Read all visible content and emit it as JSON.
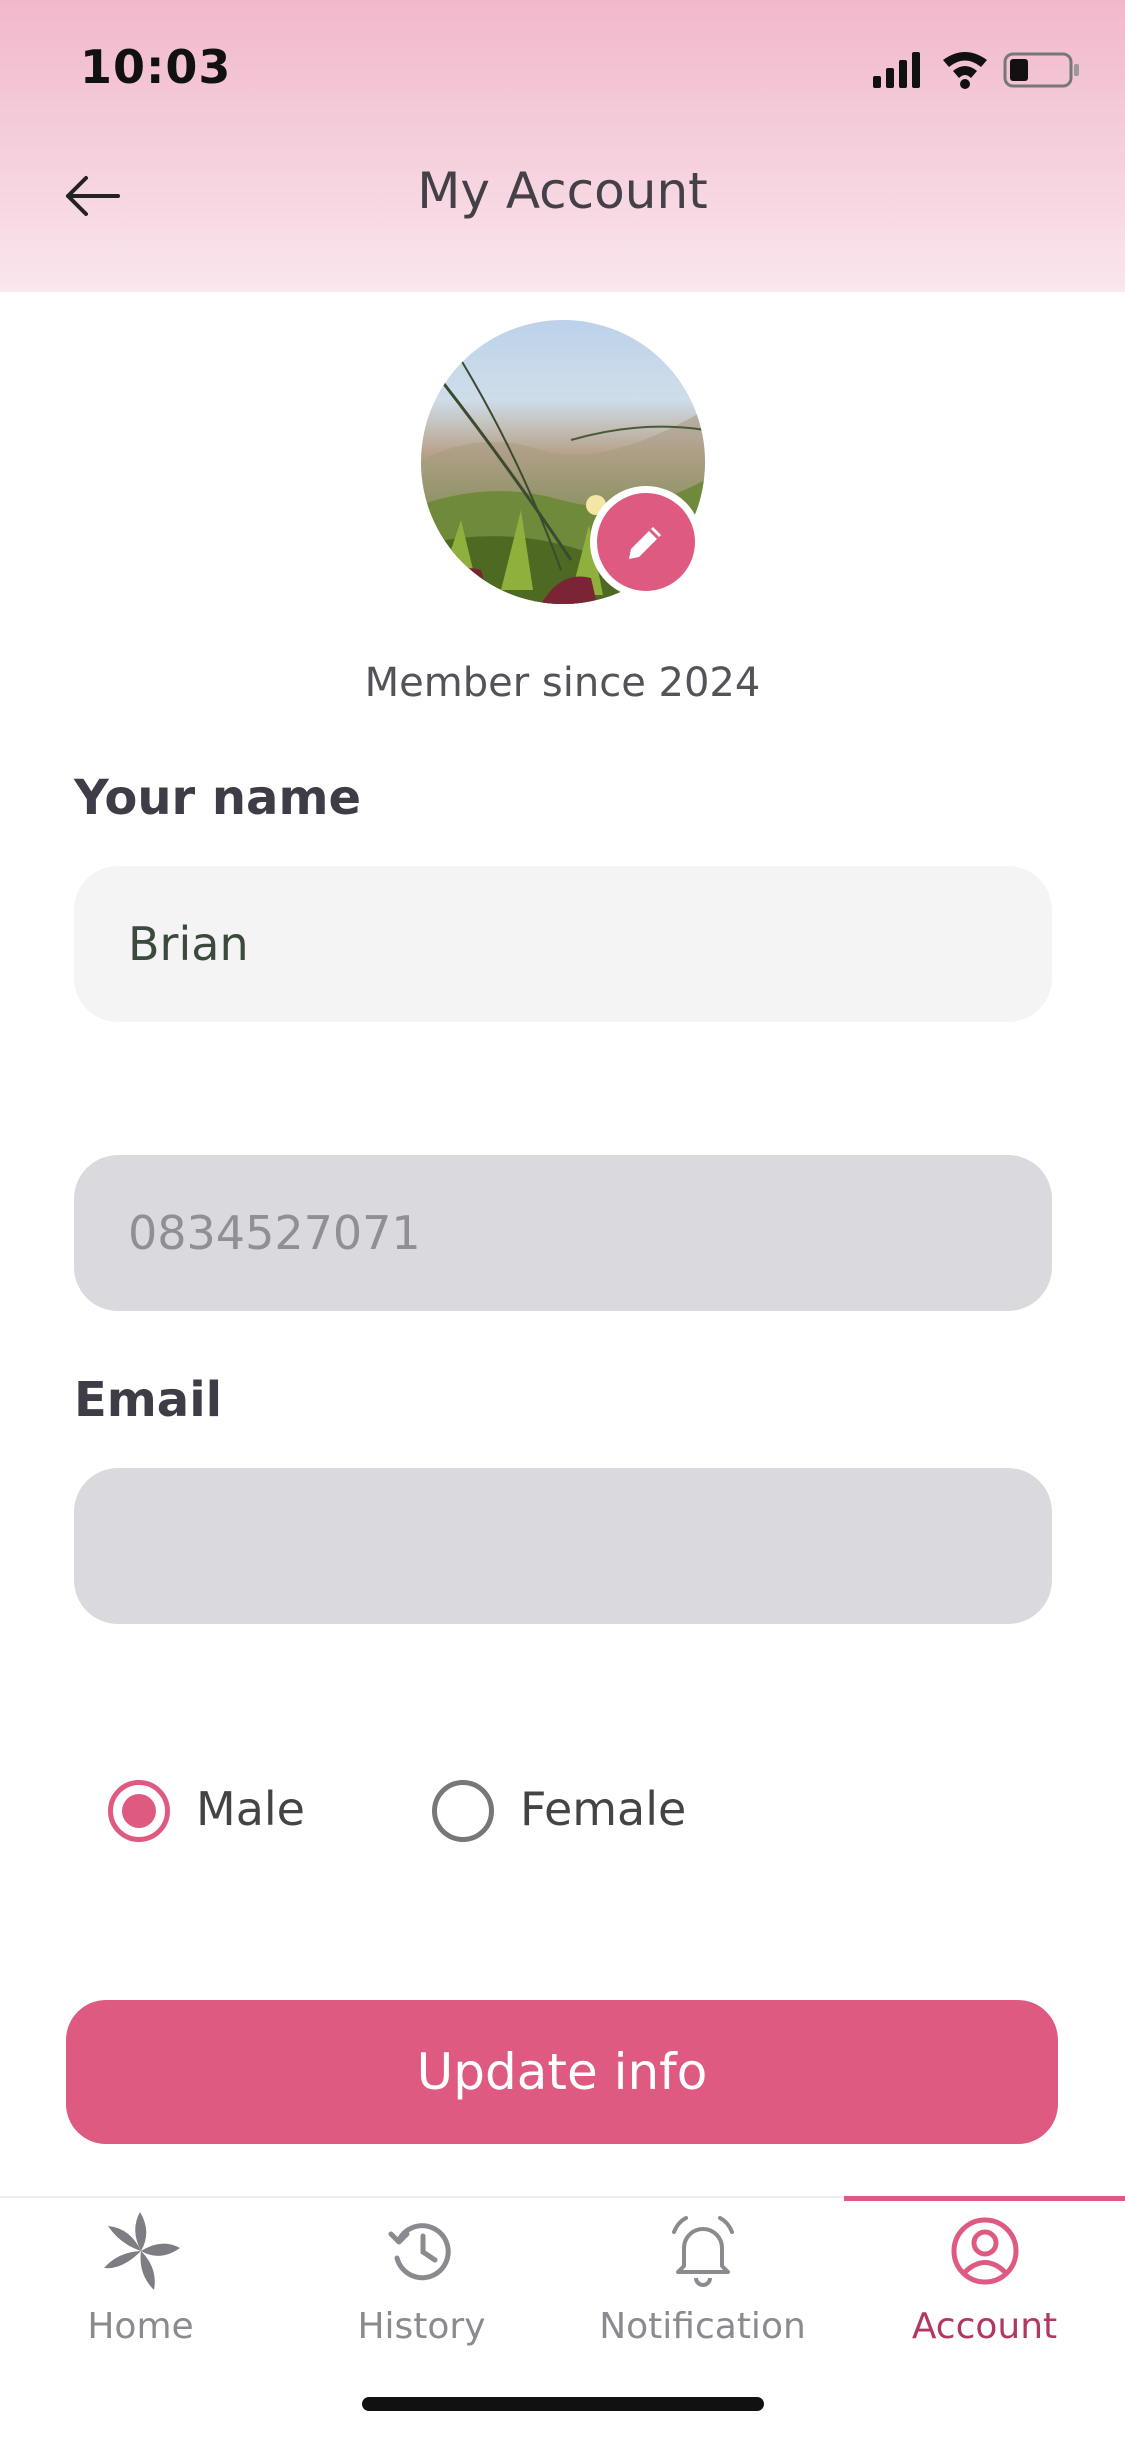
{
  "status_bar": {
    "time": "10:03"
  },
  "header": {
    "title": "My Account",
    "back_icon": "arrow-left-icon"
  },
  "profile": {
    "member_since": "Member since 2024",
    "edit_icon": "pencil-icon"
  },
  "form": {
    "name_label": "Your name",
    "name_value": "Brian",
    "phone_value": "0834527071",
    "email_label": "Email",
    "email_value": "",
    "gender_options": [
      "Male",
      "Female"
    ],
    "gender_selected": "Male",
    "submit_label": "Update info"
  },
  "tabbar": {
    "items": [
      {
        "label": "Home",
        "icon": "home-flower-icon"
      },
      {
        "label": "History",
        "icon": "history-icon"
      },
      {
        "label": "Notification",
        "icon": "bell-icon"
      },
      {
        "label": "Account",
        "icon": "account-icon"
      }
    ],
    "active": "Account"
  },
  "colors": {
    "accent": "#df5a81",
    "accent_dark": "#b03861",
    "field_disabled": "#d9d9de"
  }
}
